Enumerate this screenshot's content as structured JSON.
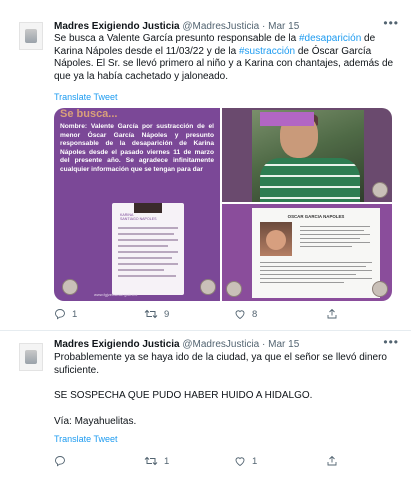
{
  "tweets": [
    {
      "author_name": "Madres Exigiendo Justicia",
      "handle": "@MadresJusticia",
      "separator": "·",
      "time": "Mar 15",
      "text_parts": [
        "Se busca a Valente García presunto responsable de la ",
        "#desaparición",
        " de Karina Nápoles desde el 11/03/22 y de la ",
        "#sustracción",
        " de Óscar García Nápoles. El Sr. se llevó primero al niño y a Karina con chantajes, además de que ya la había cachetado y jaloneado."
      ],
      "translate_label": "Translate Tweet",
      "media": {
        "poster_title": "Se busca...",
        "poster_body": "Nombre: Valente García por sustracción de el menor Óscar García Nápoles y presunto responsable de la desaparición de Karina Nápoles desde el pasado viernes 11 de marzo del presente año. Se agradece infinitamente cualquier información que se tengan para dar",
        "poster_card_caption": "KARINA\nSANTIAGO NAPOLES",
        "poster_footer": "www.fgjveracruz.gob.mx",
        "doc_heading": "OSCAR GARCIA NAPOLES"
      },
      "actions": {
        "reply": "1",
        "retweet": "9",
        "like": "8"
      }
    },
    {
      "author_name": "Madres Exigiendo Justicia",
      "handle": "@MadresJusticia",
      "separator": "·",
      "time": "Mar 15",
      "paragraphs": [
        "Probablemente ya se haya ido de la ciudad, ya que el señor se llevó dinero suficiente.",
        "SE SOSPECHA QUE PUDO HABER HUIDO A HIDALGO.",
        "Vía: Mayahuelitas."
      ],
      "translate_label": "Translate Tweet",
      "actions": {
        "reply": "",
        "retweet": "1",
        "like": "1"
      }
    }
  ],
  "icons": {
    "more": "more-horizontal-icon",
    "reply": "reply-icon",
    "retweet": "retweet-icon",
    "like": "heart-icon",
    "share": "share-icon"
  },
  "colors": {
    "link": "#1d9bf0",
    "muted": "#536471",
    "text": "#0f1419",
    "poster_purple": "#7b4897"
  }
}
